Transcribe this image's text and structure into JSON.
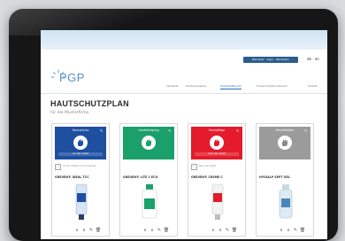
{
  "header": {
    "user_button_label": "Benutzer · login · abmelden",
    "language": "de · en",
    "logo_text": "PGP"
  },
  "nav": {
    "items": [
      {
        "label": "Startseite",
        "active": false
      },
      {
        "label": "Hautschutzpläne",
        "active": false
      },
      {
        "label": "Produkte/Bereich",
        "active": true
      },
      {
        "label": "Hautschutzpläne Bereich",
        "active": false
      },
      {
        "label": "Kontakt",
        "active": false
      }
    ]
  },
  "page": {
    "title": "HAUTSCHUTZPLAN",
    "subtitle": "für die Musterfirma"
  },
  "cards": [
    {
      "category": "Hautschutz",
      "sub": "vor der Arbeit",
      "info": "Vor der Arbeit und nach Pausen",
      "product": "GREVEN® IDEAL TCC",
      "color": "#1e4fa0",
      "product_color": "#d6e4f5",
      "accent_color": "#1e4fa0",
      "icon": "hand-protect-icon"
    },
    {
      "category": "Hautreinigung",
      "sub": "",
      "info": "",
      "product": "GREVEN® LITE 2 ECO",
      "color": "#1b9f6b",
      "product_color": "#ffffff",
      "accent_color": "#1b9f6b",
      "icon": "hand-clean-icon"
    },
    {
      "category": "Hautpflege",
      "sub": "nach der Arbeit",
      "info": "Nach der Arbeit",
      "product": "GREVEN® CREME C",
      "color": "#e31b2b",
      "product_color": "#f3f3f3",
      "accent_color": "#e31b2b",
      "icon": "hand-care-icon"
    },
    {
      "category": "Desinfektion",
      "sub": "",
      "info": "",
      "product": "HYGIALP SEPT GEL",
      "color": "#9b9b9b",
      "product_color": "#dcebf4",
      "accent_color": "#4a87b8",
      "icon": "hand-disinfect-icon"
    }
  ],
  "controls": {
    "down": "∨",
    "up": "∧",
    "edit": "✎",
    "delete": "🗑"
  }
}
